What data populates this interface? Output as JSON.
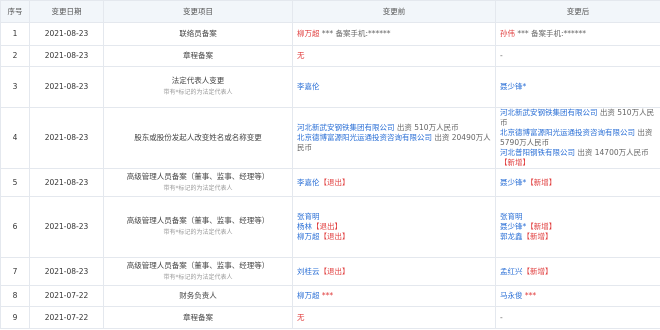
{
  "headers": [
    "序号",
    "变更日期",
    "变更项目",
    "变更前",
    "变更后"
  ],
  "rows": [
    {
      "idx": "1",
      "date": "2021-08-23",
      "item": "联络员备案",
      "sub": "",
      "before": [
        {
          "parts": [
            {
              "t": "柳万超",
              "c": "red"
            },
            {
              "t": " *** 备案手机:******",
              "c": "gray"
            }
          ]
        }
      ],
      "after": [
        {
          "parts": [
            {
              "t": "孙伟",
              "c": "red"
            },
            {
              "t": " *** 备案手机:******",
              "c": "gray"
            }
          ]
        }
      ]
    },
    {
      "idx": "2",
      "date": "2021-08-23",
      "item": "章程备案",
      "sub": "",
      "before": [
        {
          "parts": [
            {
              "t": "无",
              "c": "red"
            }
          ]
        }
      ],
      "after": [
        {
          "parts": [
            {
              "t": "-",
              "c": "gray"
            }
          ]
        }
      ]
    },
    {
      "idx": "3",
      "date": "2021-08-23",
      "item": "法定代表人变更",
      "sub": "带有*标记的为法定代表人",
      "before": [
        {
          "parts": [
            {
              "t": "李嘉伦",
              "c": "blue"
            }
          ]
        }
      ],
      "after": [
        {
          "parts": [
            {
              "t": "聂少锋*",
              "c": "blue"
            }
          ]
        }
      ]
    },
    {
      "idx": "4",
      "date": "2021-08-23",
      "item": "股东或股份发起人改变姓名或名称变更",
      "sub": "",
      "before": [
        {
          "parts": [
            {
              "t": "河北新武安钢铁集团有限公司",
              "c": "blue"
            },
            {
              "t": " 出资 510万人民币",
              "c": "gray"
            }
          ]
        },
        {
          "parts": [
            {
              "t": "北京德博富源阳光运通投资咨询有限公司",
              "c": "blue"
            },
            {
              "t": " 出资 20490万人民币",
              "c": "gray"
            }
          ]
        }
      ],
      "after": [
        {
          "parts": [
            {
              "t": "河北新武安钢铁集团有限公司",
              "c": "blue"
            },
            {
              "t": " 出资 510万人民币",
              "c": "gray"
            }
          ]
        },
        {
          "parts": [
            {
              "t": "北京德博富源阳光运通投资咨询有限公司",
              "c": "blue"
            },
            {
              "t": " 出资 5790万人民币",
              "c": "gray"
            }
          ]
        },
        {
          "parts": [
            {
              "t": "河北普阳钢铁有限公司",
              "c": "blue"
            },
            {
              "t": " 出资 14700万人民币",
              "c": "gray"
            },
            {
              "t": "【新增】",
              "c": "red"
            }
          ]
        }
      ]
    },
    {
      "idx": "5",
      "date": "2021-08-23",
      "item": "高级管理人员备案（董事、监事、经理等）",
      "sub": "带有*标记的为法定代表人",
      "before": [
        {
          "parts": [
            {
              "t": "李嘉伦",
              "c": "blue"
            },
            {
              "t": "【退出】",
              "c": "red"
            }
          ]
        }
      ],
      "after": [
        {
          "parts": [
            {
              "t": "聂少锋*",
              "c": "blue"
            },
            {
              "t": "【新增】",
              "c": "red"
            }
          ]
        }
      ]
    },
    {
      "idx": "6",
      "date": "2021-08-23",
      "item": "高级管理人员备案（董事、监事、经理等）",
      "sub": "带有*标记的为法定代表人",
      "before": [
        {
          "parts": [
            {
              "t": "张育明",
              "c": "blue"
            }
          ]
        },
        {
          "parts": [
            {
              "t": "杨林",
              "c": "blue"
            },
            {
              "t": "【退出】",
              "c": "red"
            }
          ]
        },
        {
          "parts": [
            {
              "t": "柳万超",
              "c": "blue"
            },
            {
              "t": "【退出】",
              "c": "red"
            }
          ]
        }
      ],
      "after": [
        {
          "parts": [
            {
              "t": "张育明",
              "c": "blue"
            }
          ]
        },
        {
          "parts": [
            {
              "t": "聂少锋*",
              "c": "blue"
            },
            {
              "t": "【新增】",
              "c": "red"
            }
          ]
        },
        {
          "parts": [
            {
              "t": "郭龙鑫",
              "c": "blue"
            },
            {
              "t": "【新增】",
              "c": "red"
            }
          ]
        }
      ]
    },
    {
      "idx": "7",
      "date": "2021-08-23",
      "item": "高级管理人员备案（董事、监事、经理等）",
      "sub": "带有*标记的为法定代表人",
      "before": [
        {
          "parts": [
            {
              "t": "刘桂云",
              "c": "blue"
            },
            {
              "t": "【退出】",
              "c": "red"
            }
          ]
        }
      ],
      "after": [
        {
          "parts": [
            {
              "t": "孟红兴",
              "c": "blue"
            },
            {
              "t": "【新增】",
              "c": "red"
            }
          ]
        }
      ]
    },
    {
      "idx": "8",
      "date": "2021-07-22",
      "item": "财务负责人",
      "sub": "",
      "before": [
        {
          "parts": [
            {
              "t": "柳万超",
              "c": "blue"
            },
            {
              "t": " ***",
              "c": "red"
            }
          ]
        }
      ],
      "after": [
        {
          "parts": [
            {
              "t": "马永俊",
              "c": "blue"
            },
            {
              "t": " ***",
              "c": "red"
            }
          ]
        }
      ]
    },
    {
      "idx": "9",
      "date": "2021-07-22",
      "item": "章程备案",
      "sub": "",
      "before": [
        {
          "parts": [
            {
              "t": "无",
              "c": "red"
            }
          ]
        }
      ],
      "after": [
        {
          "parts": [
            {
              "t": "-",
              "c": "gray"
            }
          ]
        }
      ]
    }
  ]
}
